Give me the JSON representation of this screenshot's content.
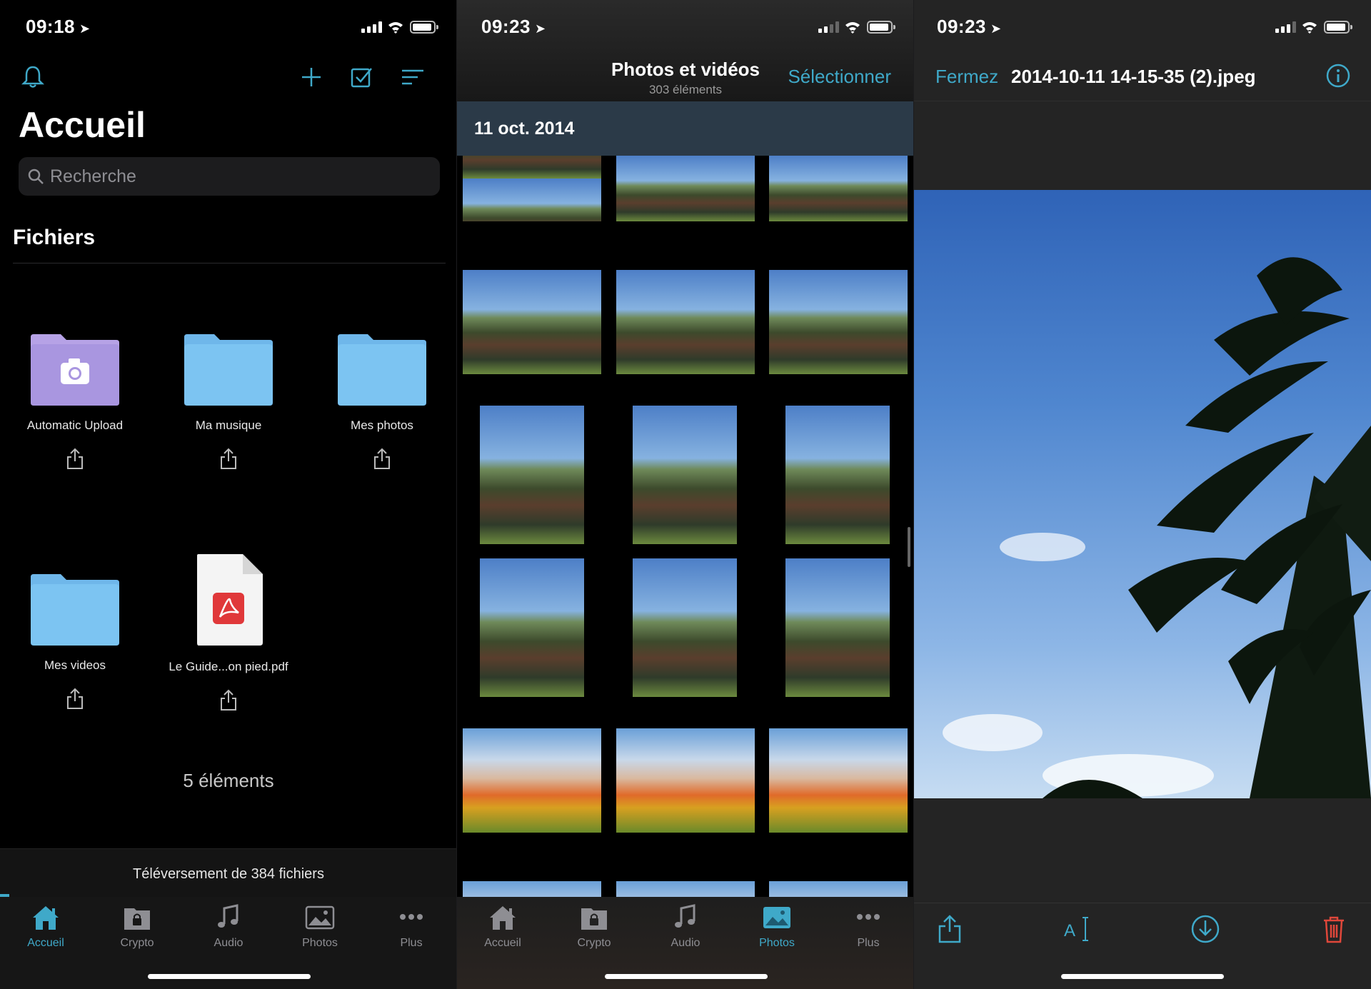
{
  "screen_home": {
    "status_time": "09:18",
    "title": "Accueil",
    "search_placeholder": "Recherche",
    "section_title": "Fichiers",
    "items": [
      {
        "label": "Automatic Upload",
        "icon": "camera-folder-icon"
      },
      {
        "label": "Ma musique",
        "icon": "folder-icon"
      },
      {
        "label": "Mes photos",
        "icon": "folder-icon"
      },
      {
        "label": "Mes videos",
        "icon": "folder-icon"
      },
      {
        "label": "Le Guide...on pied.pdf",
        "icon": "pdf-file-icon"
      }
    ],
    "count_text": "5 éléments",
    "upload_text": "Téléversement de 384 fichiers",
    "upload_progress": 0.02
  },
  "screen_photos": {
    "status_time": "09:23",
    "title": "Photos et vidéos",
    "subtitle": "303 éléments",
    "select_label": "Sélectionner",
    "date_header": "11 oct. 2014"
  },
  "screen_viewer": {
    "status_time": "09:23",
    "close_label": "Fermez",
    "file_name": "2014-10-11 14-15-35 (2).jpeg",
    "toolbar": [
      "share-icon",
      "rename-icon",
      "download-icon",
      "trash-icon"
    ]
  },
  "tabs": [
    {
      "label": "Accueil",
      "icon": "home-icon"
    },
    {
      "label": "Crypto",
      "icon": "crypto-folder-icon"
    },
    {
      "label": "Audio",
      "icon": "music-note-icon"
    },
    {
      "label": "Photos",
      "icon": "photos-icon"
    },
    {
      "label": "Plus",
      "icon": "more-icon"
    }
  ],
  "colors": {
    "accent": "#3fa9c9",
    "folder_blue": "#7cc4f2",
    "upload_folder": "#b6a2e6",
    "delete_red": "#e0473a"
  }
}
